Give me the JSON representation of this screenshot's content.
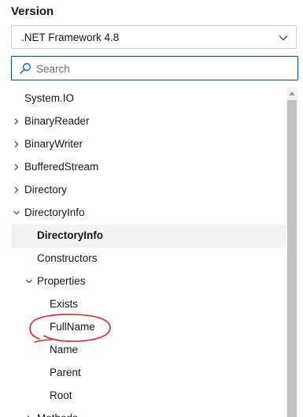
{
  "version": {
    "label": "Version",
    "selected": ".NET Framework 4.8"
  },
  "search": {
    "placeholder": "Search",
    "value": ""
  },
  "tree": {
    "rows": [
      {
        "label": "System.IO",
        "depth": 0,
        "arrow": "none",
        "selected": false
      },
      {
        "label": "BinaryReader",
        "depth": 0,
        "arrow": "right",
        "selected": false
      },
      {
        "label": "BinaryWriter",
        "depth": 0,
        "arrow": "right",
        "selected": false
      },
      {
        "label": "BufferedStream",
        "depth": 0,
        "arrow": "right",
        "selected": false
      },
      {
        "label": "Directory",
        "depth": 0,
        "arrow": "right",
        "selected": false
      },
      {
        "label": "DirectoryInfo",
        "depth": 0,
        "arrow": "down",
        "selected": false
      },
      {
        "label": "DirectoryInfo",
        "depth": 1,
        "arrow": "none",
        "selected": true
      },
      {
        "label": "Constructors",
        "depth": 1,
        "arrow": "none",
        "selected": false
      },
      {
        "label": "Properties",
        "depth": 1,
        "arrow": "down",
        "selected": false
      },
      {
        "label": "Exists",
        "depth": 2,
        "arrow": "none",
        "selected": false
      },
      {
        "label": "FullName",
        "depth": 2,
        "arrow": "none",
        "selected": false
      },
      {
        "label": "Name",
        "depth": 2,
        "arrow": "none",
        "selected": false
      },
      {
        "label": "Parent",
        "depth": 2,
        "arrow": "none",
        "selected": false
      },
      {
        "label": "Root",
        "depth": 2,
        "arrow": "none",
        "selected": false
      },
      {
        "label": "Methods",
        "depth": 1,
        "arrow": "right",
        "selected": false
      }
    ]
  },
  "colors": {
    "accent": "#0e5a9c",
    "selected_bg": "#f2f2f2",
    "annotation": "#d9262c",
    "scroll_thumb": "#c1c1c1"
  },
  "icons": {
    "select_chevron": "chevron-down-icon",
    "search": "search-icon",
    "tree_collapsed": "chevron-right-icon",
    "tree_expanded": "chevron-down-icon",
    "scroll_up": "scroll-up-arrow-icon"
  }
}
